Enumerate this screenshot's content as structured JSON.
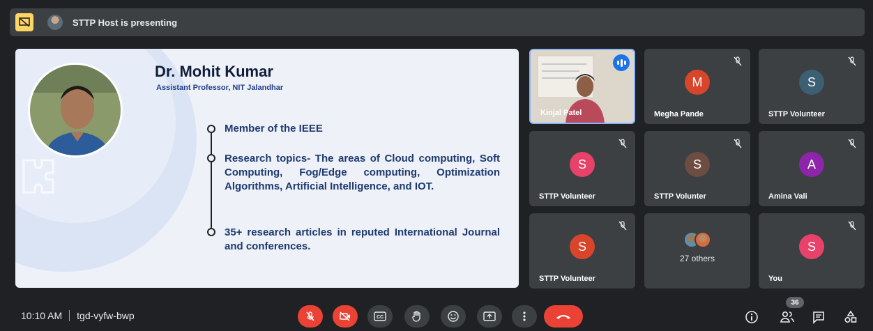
{
  "top_bar": {
    "presenting_text": "STTP Host is presenting",
    "icons": [
      "stop-presentation-icon",
      "presenter-avatar"
    ]
  },
  "slide": {
    "name": "Dr. Mohit Kumar",
    "title": "Assistant Professor, NIT Jalandhar",
    "bullets": [
      "Member of the IEEE",
      "Research topics- The areas of Cloud computing, Soft Computing, Fog/Edge computing, Optimization Algorithms, Artificial Intelligence, and IOT.",
      "35+ research articles in reputed International Journal and conferences."
    ]
  },
  "participants": [
    {
      "name": "Kinjal Patel",
      "initial": "",
      "color": "",
      "video": true,
      "speaking": true,
      "muted": false
    },
    {
      "name": "Megha Pande",
      "initial": "M",
      "color": "#d9452b",
      "muted": true
    },
    {
      "name": "STTP Volunteer",
      "initial": "S",
      "color": "#3d5f73",
      "muted": true
    },
    {
      "name": "STTP Volunteer",
      "initial": "S",
      "color": "#e8426b",
      "muted": true
    },
    {
      "name": "STTP Volunter",
      "initial": "S",
      "color": "#6d4c41",
      "muted": true
    },
    {
      "name": "Amina Vali",
      "initial": "A",
      "color": "#8e24aa",
      "muted": true
    },
    {
      "name": "STTP Volunteer",
      "initial": "S",
      "color": "#d9452b",
      "muted": true
    },
    {
      "name": "27 others",
      "others": true
    },
    {
      "name": "You",
      "initial": "S",
      "color": "#e8426b",
      "muted": true
    }
  ],
  "bottom_bar": {
    "time": "10:10 AM",
    "meeting_code": "tgd-vyfw-bwp",
    "people_count": "36",
    "controls": [
      "mic-off-icon",
      "camera-off-icon",
      "captions-icon",
      "raise-hand-icon",
      "emoji-icon",
      "present-icon",
      "more-options-icon",
      "end-call-icon"
    ],
    "right_controls": [
      "info-icon",
      "people-icon",
      "chat-icon",
      "activities-icon"
    ]
  }
}
